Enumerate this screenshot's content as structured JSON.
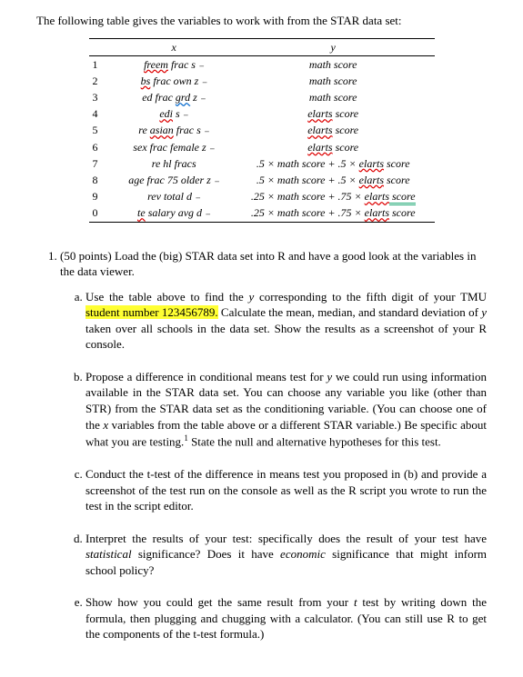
{
  "intro": "The following table gives the variables to work with from the STAR data set:",
  "table": {
    "head": {
      "x": "x",
      "y": "y"
    },
    "rows": [
      {
        "idx": "1",
        "x_a": "freem",
        "x_b": " frac s  ₋",
        "y_a": "math scᴏre",
        "y_b": ""
      },
      {
        "idx": "2",
        "x_a": "bs",
        "x_b": " frac own z  ₋",
        "y_a": "math scᴏre",
        "y_b": ""
      },
      {
        "idx": "3",
        "x_a": "ed frac ",
        "x_b_blue": "grd",
        "x_c": " z  ₋",
        "y_a": "math scᴏre",
        "y_b": ""
      },
      {
        "idx": "4",
        "x_a": "edi",
        "x_b": " s  ₋",
        "y_a": "elarts",
        "y_b": " scᴏre"
      },
      {
        "idx": "5",
        "x_a": "re ",
        "x_b_red": "asian",
        "x_c": " frac s  ₋",
        "y_a": "elarts",
        "y_b": " scᴏre"
      },
      {
        "idx": "6",
        "x_a": "sex frac female z  ₋",
        "y_a": "elarts",
        "y_b": " scᴏre"
      },
      {
        "idx": "7",
        "x_a": "re hl fracs",
        "y_pre": ".5 × math scᴏre + .5 × ",
        "y_a": "elarts",
        "y_b": " scᴏre"
      },
      {
        "idx": "8",
        "x_a": "age frac 75 older z  ₋",
        "y_pre": ".5 × math scᴏre + .5 × ",
        "y_a": "elarts",
        "y_b": " scᴏre"
      },
      {
        "idx": "9",
        "x_a": "rev total d  ₋",
        "y_pre": ".25 × math scᴏre + .75 × ",
        "y_a": "elarts",
        "y_b": " scᴏre"
      },
      {
        "idx": "0",
        "x_a": "te",
        "x_b": " salary avg  d  ₋",
        "y_pre": ".25 × math scᴏre + .75 × ",
        "y_a": "elarts",
        "y_b": " scᴏre"
      }
    ]
  },
  "q1": {
    "points": "(50 points)",
    "stem": " Load the (big) STAR data set into R and have a good look at the variables in the data viewer.",
    "a_pre": "Use the table above to find the ",
    "a_y": "y",
    "a_mid1": " corresponding to the fifth digit of your TMU ",
    "a_hl": "student number 123456789.",
    "a_post": " Calculate the mean, median, and standard deviation of ",
    "a_y2": "y",
    "a_tail": " taken over all schools in the data set. Show the results as a screenshot of your R console.",
    "b_pre": "Propose a difference in conditional means test for ",
    "b_y": "y",
    "b_mid": " we could run using information available in the STAR data set. You can choose any variable you like (other than STR) from the STAR data set as the conditioning variable. (You can choose one of the ",
    "b_x": "x",
    "b_mid2": " variables from the table above or a different STAR variable.) Be specific about what you are testing.",
    "b_fn": "1",
    "b_tail": " State the null and alternative hypotheses for this test.",
    "c": "Conduct the t-test of the difference in means test you proposed in (b) and provide a screenshot of the test run on the console as well as the R script you wrote to run the test in the script editor.",
    "d_pre": "Interpret the results of your test: specifically does the result of your test have ",
    "d_i1": "statistical",
    "d_mid": " significance? Does it have ",
    "d_i2": "economic",
    "d_tail": " significance that might inform school policy?",
    "e_pre": "Show how you could get the same result from your ",
    "e_t": "t",
    "e_tail": " test by writing down the formula, then plugging and chugging with a calculator. (You can still use R to get the components of the t-test formula.)"
  }
}
